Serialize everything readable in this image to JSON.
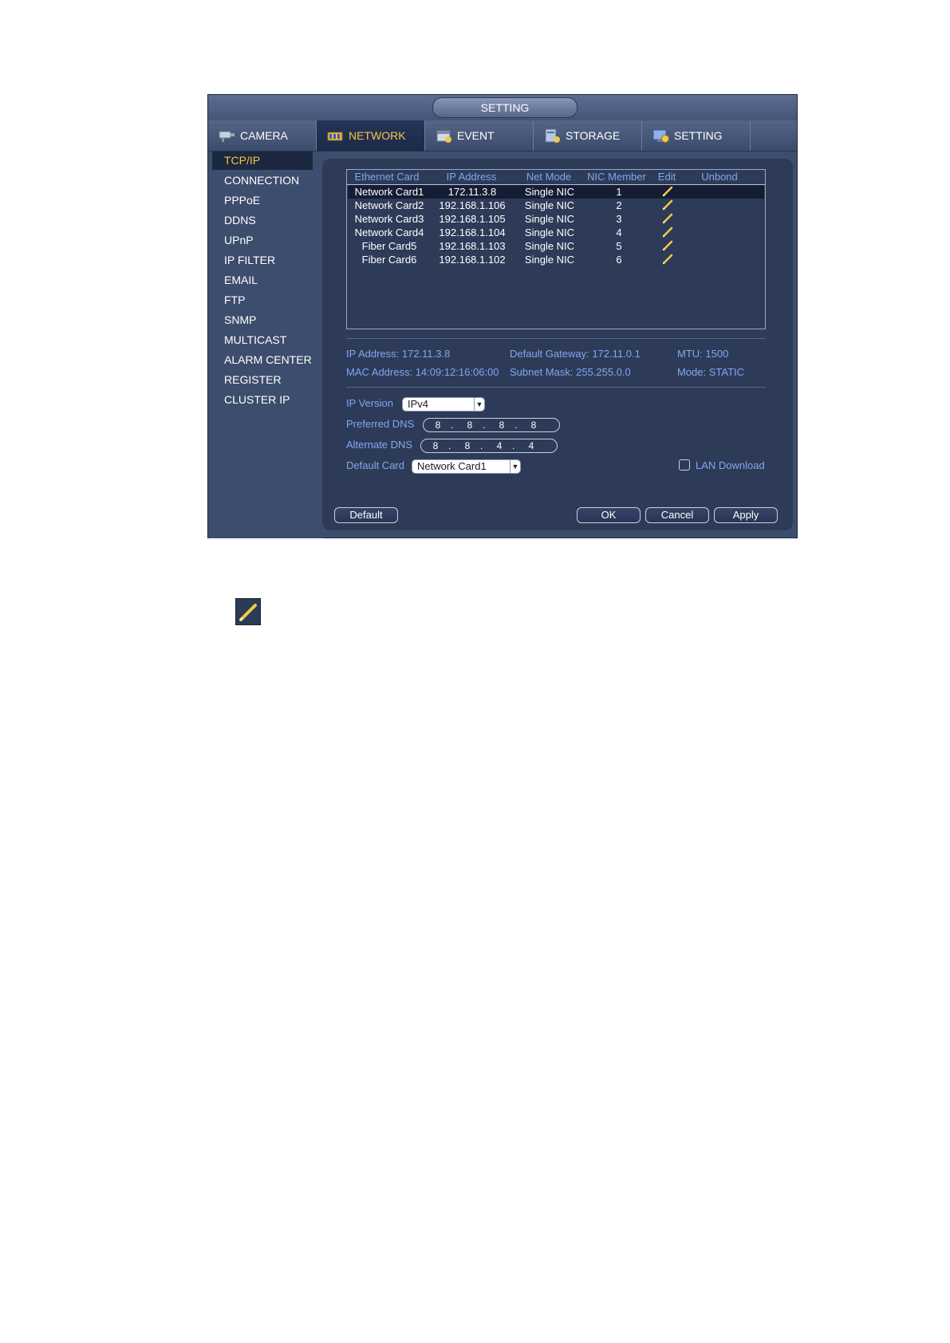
{
  "window": {
    "title": "SETTING"
  },
  "tabs": [
    {
      "label": "CAMERA",
      "icon": "camera-icon",
      "active": false
    },
    {
      "label": "NETWORK",
      "icon": "network-icon",
      "active": true
    },
    {
      "label": "EVENT",
      "icon": "event-icon",
      "active": false
    },
    {
      "label": "STORAGE",
      "icon": "storage-icon",
      "active": false
    },
    {
      "label": "SETTING",
      "icon": "setting-icon",
      "active": false
    }
  ],
  "sidebar": {
    "items": [
      {
        "label": "TCP/IP",
        "active": true
      },
      {
        "label": "CONNECTION"
      },
      {
        "label": "PPPoE"
      },
      {
        "label": "DDNS"
      },
      {
        "label": "UPnP"
      },
      {
        "label": "IP FILTER"
      },
      {
        "label": "EMAIL"
      },
      {
        "label": "FTP"
      },
      {
        "label": "SNMP"
      },
      {
        "label": "MULTICAST"
      },
      {
        "label": "ALARM CENTER"
      },
      {
        "label": "REGISTER"
      },
      {
        "label": "CLUSTER IP"
      }
    ]
  },
  "table": {
    "headers": [
      "Ethernet Card",
      "IP Address",
      "Net Mode",
      "NIC Member",
      "Edit",
      "Unbond"
    ],
    "rows": [
      {
        "card": "Network Card1",
        "ip": "172.11.3.8",
        "mode": "Single NIC",
        "member": "1",
        "selected": true
      },
      {
        "card": "Network Card2",
        "ip": "192.168.1.106",
        "mode": "Single NIC",
        "member": "2"
      },
      {
        "card": "Network Card3",
        "ip": "192.168.1.105",
        "mode": "Single NIC",
        "member": "3"
      },
      {
        "card": "Network Card4",
        "ip": "192.168.1.104",
        "mode": "Single NIC",
        "member": "4"
      },
      {
        "card": "Fiber Card5",
        "ip": "192.168.1.103",
        "mode": "Single NIC",
        "member": "5"
      },
      {
        "card": "Fiber Card6",
        "ip": "192.168.1.102",
        "mode": "Single NIC",
        "member": "6"
      }
    ]
  },
  "info": {
    "ip_address": "IP Address: 172.11.3.8",
    "default_gateway": "Default Gateway: 172.11.0.1",
    "mtu": "MTU: 1500",
    "mac_address": "MAC Address: 14:09:12:16:06:00",
    "subnet_mask": "Subnet Mask: 255.255.0.0",
    "mode": "Mode: STATIC"
  },
  "form": {
    "ip_version_label": "IP Version",
    "ip_version_value": "IPv4",
    "preferred_dns_label": "Preferred DNS",
    "preferred_dns": [
      "8",
      "8",
      "8",
      "8"
    ],
    "alternate_dns_label": "Alternate DNS",
    "alternate_dns": [
      "8",
      "8",
      "4",
      "4"
    ],
    "default_card_label": "Default Card",
    "default_card_value": "Network Card1",
    "lan_download_label": "LAN Download",
    "lan_download_checked": false
  },
  "buttons": {
    "default": "Default",
    "ok": "OK",
    "cancel": "Cancel",
    "apply": "Apply"
  },
  "colors": {
    "accent": "#f7c642",
    "label_blue": "#7fa8f0",
    "panel": "#2d3b58"
  },
  "legend": {
    "icon": "edit-pencil-icon"
  }
}
